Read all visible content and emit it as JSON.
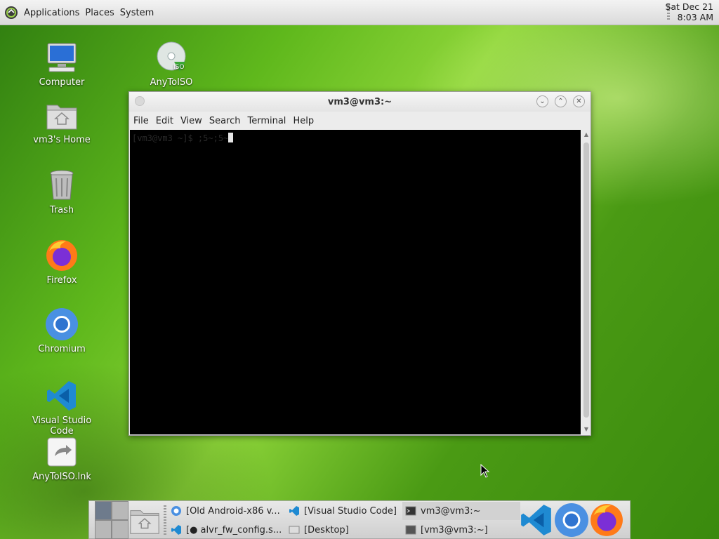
{
  "top_panel": {
    "menus": [
      "Applications",
      "Places",
      "System"
    ],
    "clock": {
      "date": "Sat Dec 21",
      "time": "8:03 AM"
    }
  },
  "desktop_icons": [
    {
      "label": "Computer",
      "icon": "computer-icon"
    },
    {
      "label": "vm3's Home",
      "icon": "home-folder-icon"
    },
    {
      "label": "Trash",
      "icon": "trash-icon"
    },
    {
      "label": "Firefox",
      "icon": "firefox-icon"
    },
    {
      "label": "Chromium",
      "icon": "chromium-icon"
    },
    {
      "label": "Visual Studio Code",
      "icon": "vscode-icon"
    },
    {
      "label": "AnyToISO.lnk",
      "icon": "shortcut-icon"
    },
    {
      "label": "AnyToISO",
      "icon": "anytoiso-disc-icon"
    }
  ],
  "terminal": {
    "title": "vm3@vm3:~",
    "menu": [
      "File",
      "Edit",
      "View",
      "Search",
      "Terminal",
      "Help"
    ],
    "prompt": "[vm3@vm3 ~]$ ;5~;5~"
  },
  "taskbar": {
    "tasks": [
      {
        "label": "[Old Android-x86 v...",
        "icon": "chromium-icon"
      },
      {
        "label": "[Visual Studio Code]",
        "icon": "vscode-icon"
      },
      {
        "label": "vm3@vm3:~",
        "icon": "terminal-icon",
        "active": true
      },
      {
        "label": "[● alvr_fw_config.s...",
        "icon": "vscode-icon"
      },
      {
        "label": "[Desktop]",
        "icon": "desktop-icon"
      },
      {
        "label": "[vm3@vm3:~]",
        "icon": "terminal-icon"
      }
    ],
    "launchers": [
      "vscode-icon",
      "chromium-icon",
      "firefox-icon"
    ]
  },
  "colors": {
    "panel": "#e4e4e4",
    "terminal_bg": "#000000",
    "desktop_green": "#5fb81c"
  }
}
